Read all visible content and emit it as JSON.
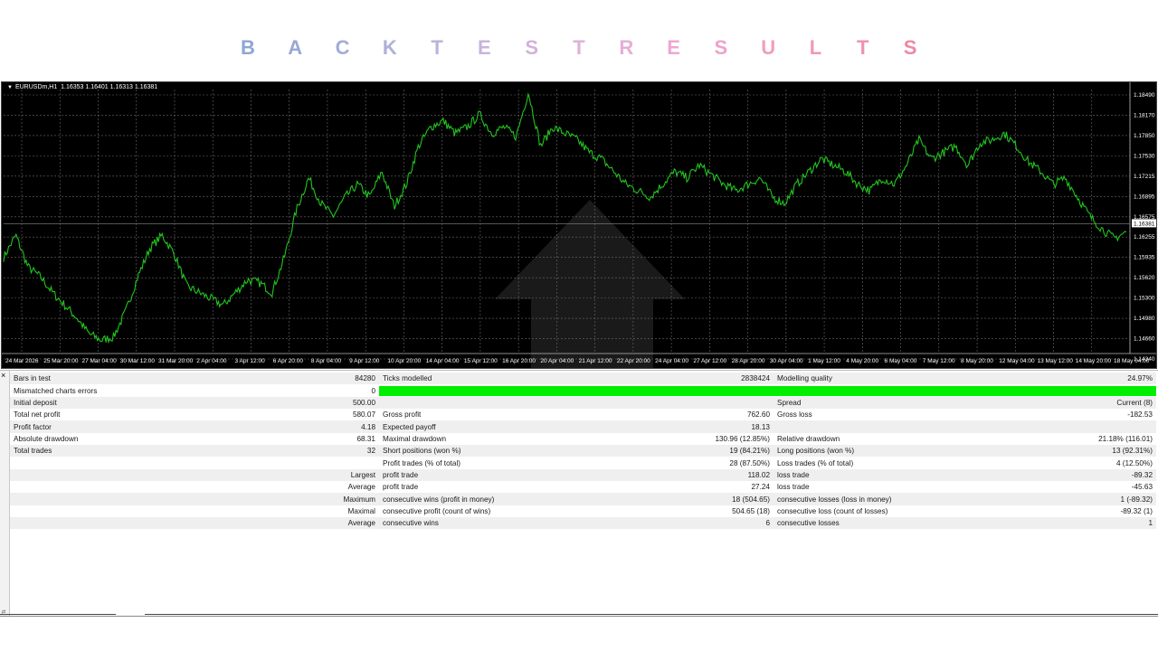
{
  "title": {
    "letters": [
      "B",
      "A",
      "C",
      "K",
      "T",
      "E",
      "S",
      "T",
      "R",
      "E",
      "S",
      "U",
      "L",
      "T",
      "S"
    ],
    "colors": [
      "#8fa6d6",
      "#97a8d8",
      "#a3acd9",
      "#b0afdb",
      "#bcb2dc",
      "#c8b4dd",
      "#d2b2dc",
      "#dcb2da",
      "#e5aed5",
      "#eca8cf",
      "#efa3c8",
      "#f09dc0",
      "#f097b7",
      "#ef91ae",
      "#ec8aa4"
    ]
  },
  "chart": {
    "symbol_label": "EURUSDm,H1",
    "ohlc": "1.16353 1.16401 1.16313 1.16381",
    "current_price": "1.16381",
    "price_levels": [
      "1.18490",
      "1.18170",
      "1.17850",
      "1.17530",
      "1.17215",
      "1.16895",
      "1.16575",
      "1.16255",
      "1.15935",
      "1.15620",
      "1.15300",
      "1.14980",
      "1.14660",
      "1.14340"
    ],
    "time_labels": [
      "24 Mar 2026",
      "25 Mar 20:00",
      "27 Mar 04:00",
      "30 Mar 12:00",
      "31 Mar 20:00",
      "2 Apr 04:00",
      "3 Apr 12:00",
      "6 Apr 20:00",
      "8 Apr 04:00",
      "9 Apr 12:00",
      "10 Apr 20:00",
      "14 Apr 04:00",
      "15 Apr 12:00",
      "16 Apr 20:00",
      "20 Apr 04:00",
      "21 Apr 12:00",
      "22 Apr 20:00",
      "24 Apr 04:00",
      "27 Apr 12:00",
      "28 Apr 20:00",
      "30 Apr 04:00",
      "1 May 12:00",
      "4 May 20:00",
      "6 May 04:00",
      "7 May 12:00",
      "8 May 20:00",
      "12 May 04:00",
      "13 May 12:00",
      "14 May 20:00",
      "18 May 04:00"
    ],
    "price_range": [
      1.1434,
      1.1849
    ],
    "price_path": [
      1.1585,
      1.162,
      1.157,
      1.1555,
      1.153,
      1.151,
      1.149,
      1.1465,
      1.1455,
      1.146,
      1.15,
      1.1555,
      1.16,
      1.162,
      1.159,
      1.154,
      1.153,
      1.152,
      1.151,
      1.153,
      1.155,
      1.1545,
      1.153,
      1.1585,
      1.166,
      1.171,
      1.167,
      1.165,
      1.168,
      1.17,
      1.168,
      1.172,
      1.1665,
      1.17,
      1.176,
      1.179,
      1.18,
      1.178,
      1.179,
      1.181,
      1.178,
      1.179,
      1.1775,
      1.1845,
      1.176,
      1.179,
      1.178,
      1.177,
      1.175,
      1.174,
      1.172,
      1.17,
      1.169,
      1.168,
      1.17,
      1.172,
      1.171,
      1.173,
      1.1715,
      1.17,
      1.169,
      1.17,
      1.171,
      1.168,
      1.167,
      1.17,
      1.172,
      1.174,
      1.173,
      1.172,
      1.17,
      1.169,
      1.171,
      1.17,
      1.173,
      1.177,
      1.174,
      1.175,
      1.176,
      1.173,
      1.1765,
      1.177,
      1.178,
      1.176,
      1.1735,
      1.172,
      1.17,
      1.171,
      1.168,
      1.165,
      1.163,
      1.1615,
      1.1625
    ]
  },
  "report": {
    "rows": [
      {
        "c1": "Bars in test",
        "c2": "84280",
        "c3": "Ticks modelled",
        "c4": "2838424",
        "c5": "Modelling quality",
        "c6": "24.97%"
      },
      {
        "c1": "Mismatched charts errors",
        "c2": "0",
        "bar": true
      },
      {
        "c1": "Initial deposit",
        "c2": "500.00",
        "c3": "",
        "c4": "",
        "c5": "Spread",
        "c6": "Current (8)"
      },
      {
        "c1": "Total net profit",
        "c2": "580.07",
        "c3": "Gross profit",
        "c4": "762.60",
        "c5": "Gross loss",
        "c6": "-182.53"
      },
      {
        "c1": "Profit factor",
        "c2": "4.18",
        "c3": "Expected payoff",
        "c4": "18.13",
        "c5": "",
        "c6": ""
      },
      {
        "c1": "Absolute drawdown",
        "c2": "68.31",
        "c3": "Maximal drawdown",
        "c4": "130.96 (12.85%)",
        "c5": "Relative drawdown",
        "c6": "21.18% (116.01)"
      },
      {
        "c1": "Total trades",
        "c2": "32",
        "c3": "Short positions (won %)",
        "c4": "19 (84.21%)",
        "c5": "Long positions (won %)",
        "c6": "13 (92.31%)"
      },
      {
        "c1": "",
        "c2": "",
        "c3": "Profit trades (% of total)",
        "c4": "28 (87.50%)",
        "c5": "Loss trades (% of total)",
        "c6": "4 (12.50%)"
      },
      {
        "c1": "",
        "c2": "Largest",
        "c3": "profit trade",
        "c4": "118.02",
        "c5": "loss trade",
        "c6": "-89.32"
      },
      {
        "c1": "",
        "c2": "Average",
        "c3": "profit trade",
        "c4": "27.24",
        "c5": "loss trade",
        "c6": "-45.63"
      },
      {
        "c1": "",
        "c2": "Maximum",
        "c3": "consecutive wins (profit in money)",
        "c4": "18 (504.65)",
        "c5": "consecutive losses (loss in money)",
        "c6": "1 (-89.32)"
      },
      {
        "c1": "",
        "c2": "Maximal",
        "c3": "consecutive profit (count of wins)",
        "c4": "504.65 (18)",
        "c5": "consecutive loss (count of losses)",
        "c6": "-89.32 (1)"
      },
      {
        "c1": "",
        "c2": "Average",
        "c3": "consecutive wins",
        "c4": "6",
        "c5": "consecutive losses",
        "c6": "1"
      }
    ]
  },
  "colors": {
    "candle": "#22c41e",
    "grid": "#6a6a6a",
    "chart_bg": "#000000",
    "quality_bar": "#00ee00"
  }
}
